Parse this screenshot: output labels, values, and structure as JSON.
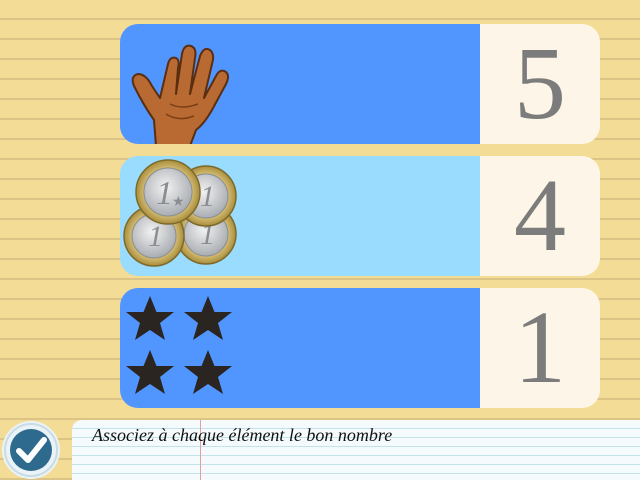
{
  "instruction": "Associez à chaque élément le bon nombre",
  "colors": {
    "row_dark_blue": "#5195ff",
    "row_light_blue": "#99dcfe",
    "number_panel": "#fdf6e8",
    "number_text": "#7c7c7c",
    "check_button": "#2d6a8d"
  },
  "rows": [
    {
      "picture": "hand-icon",
      "count": 5,
      "number": "5",
      "bg": "#5195ff"
    },
    {
      "picture": "euro-coin-icon",
      "count": 4,
      "number": "4",
      "bg": "#99dcfe"
    },
    {
      "picture": "star-icon",
      "count": 4,
      "number": "1",
      "bg": "#5195ff"
    }
  ],
  "coins": {
    "label": "1"
  },
  "check_button": {
    "icon": "checkmark-icon"
  }
}
